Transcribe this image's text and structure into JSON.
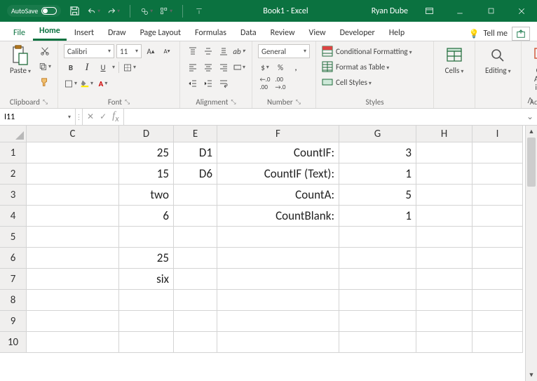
{
  "titlebar": {
    "autosave_label": "AutoSave",
    "autosave_state": "Off",
    "title": "Book1 - Excel",
    "user": "Ryan Dube"
  },
  "tabs": {
    "file": "File",
    "home": "Home",
    "insert": "Insert",
    "draw": "Draw",
    "pagelayout": "Page Layout",
    "formulas": "Formulas",
    "data": "Data",
    "review": "Review",
    "view": "View",
    "developer": "Developer",
    "help": "Help",
    "tellme": "Tell me"
  },
  "ribbon": {
    "clipboard": {
      "label": "Clipboard",
      "paste": "Paste"
    },
    "font": {
      "label": "Font",
      "name": "Calibri",
      "size": "11"
    },
    "alignment": {
      "label": "Alignment"
    },
    "number": {
      "label": "Number",
      "format": "General"
    },
    "styles": {
      "label": "Styles",
      "cond": "Conditional Formatting",
      "table": "Format as Table",
      "cell": "Cell Styles"
    },
    "cells": {
      "label": "Cells"
    },
    "editing": {
      "label": "Editing"
    },
    "addins": {
      "label": "Add-ins",
      "get1": "Get",
      "get2": "Add-ins"
    }
  },
  "formulabar": {
    "cellref": "I11",
    "formula": ""
  },
  "columns": [
    "C",
    "D",
    "E",
    "F",
    "G",
    "H",
    "I"
  ],
  "rows": [
    "1",
    "2",
    "3",
    "4",
    "5",
    "6",
    "7",
    "8",
    "9",
    "10"
  ],
  "cells": {
    "D1": "25",
    "E1": "D1",
    "F1": "CountIF:",
    "G1": "3",
    "D2": "15",
    "E2": "D6",
    "F2": "CountIF (Text):",
    "G2": "1",
    "D3": "two",
    "F3": "CountA:",
    "G3": "5",
    "D4": "6",
    "F4": "CountBlank:",
    "G4": "1",
    "D6": "25",
    "D7": "six"
  },
  "chart_data": null
}
